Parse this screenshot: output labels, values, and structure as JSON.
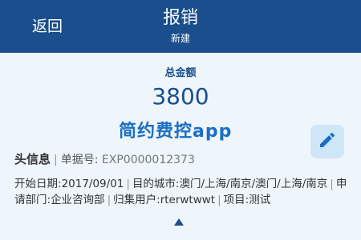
{
  "header": {
    "back_label": "返回",
    "title": "报销",
    "subtitle": "新建"
  },
  "total": {
    "label": "总金额",
    "value": "3800"
  },
  "watermark": "简约费控app",
  "section": {
    "title": "头信息",
    "doc_label": "单据号:",
    "doc_number": "EXP0000012373"
  },
  "details": {
    "start_date_label": "开始日期:",
    "start_date": "2017/09/01",
    "destination_label": "目的城市:",
    "destination": "澳门/上海/南京/澳门/上海/南京",
    "department_label": "申请部门:",
    "department": "企业咨询部",
    "user_label": "归集用户:",
    "user": "rterwtwwt",
    "project_label": "项目:",
    "project": "测试"
  },
  "icons": {
    "edit": "pencil-icon",
    "expand": "caret-up-icon"
  },
  "colors": {
    "header_bg": "#1a4e8c",
    "accent": "#1a4e8c",
    "content_bg": "#eef5fb"
  }
}
